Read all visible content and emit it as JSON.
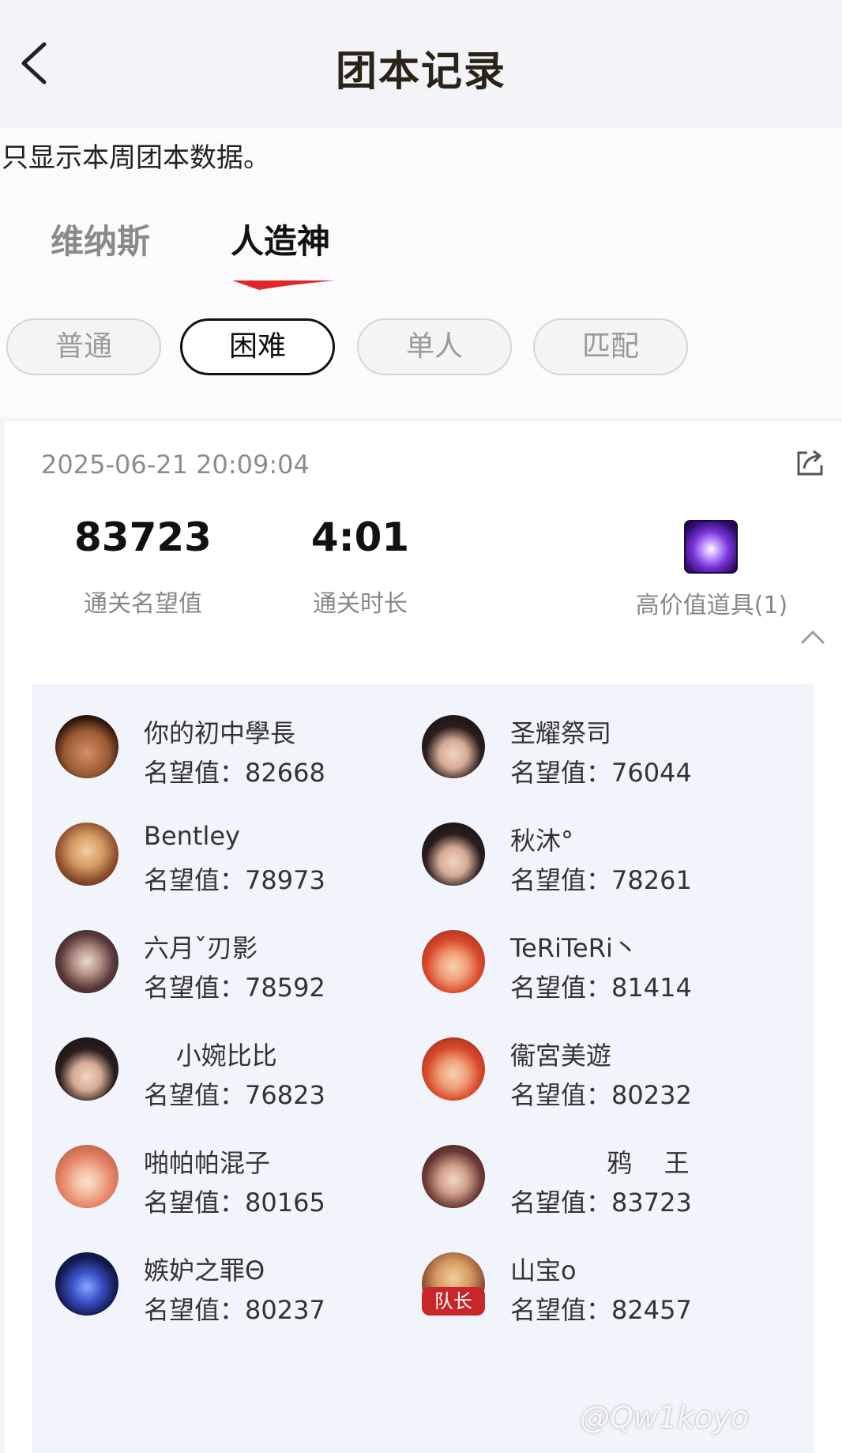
{
  "header": {
    "title": "团本记录"
  },
  "notice": "只显示本周团本数据。",
  "tabs": [
    {
      "label": "维纳斯",
      "active": false
    },
    {
      "label": "人造神",
      "active": true
    }
  ],
  "modes": [
    {
      "label": "普通",
      "active": false
    },
    {
      "label": "困难",
      "active": true
    },
    {
      "label": "单人",
      "active": false
    },
    {
      "label": "匹配",
      "active": false
    }
  ],
  "record": {
    "timestamp": "2025-06-21 20:09:04",
    "fame": {
      "value": "83723",
      "label": "通关名望值"
    },
    "duration": {
      "value": "4:01",
      "label": "通关时长"
    },
    "items": {
      "label": "高价值道具(1)"
    }
  },
  "members": [
    {
      "name": "你的初中學長",
      "score": "名望值：82668"
    },
    {
      "name": "圣耀祭司",
      "score": "名望值：76044"
    },
    {
      "name": "Bentley",
      "score": "名望值：78973"
    },
    {
      "name": "秋沐°",
      "score": "名望值：78261"
    },
    {
      "name": "六月ˇ刃影",
      "score": "名望值：78592"
    },
    {
      "name": "TeRiTeRi丶",
      "score": "名望值：81414"
    },
    {
      "name": "    小婉比比",
      "score": "名望值：76823"
    },
    {
      "name": "衞宮美遊",
      "score": "名望值：80232"
    },
    {
      "name": "啪帕帕混子",
      "score": "名望值：80165"
    },
    {
      "name": "            鸦    王",
      "score": "名望值：83723"
    },
    {
      "name": "嫉妒之罪Θ",
      "score": "名望值：80237"
    },
    {
      "name": "山宝o",
      "score": "名望值：82457",
      "badge": "队长"
    }
  ],
  "watermark": "@Qw1koyo",
  "colors": {
    "accent": "#e0262b",
    "roster_bg": "#f1f4fa",
    "badge": "#c8262b"
  }
}
